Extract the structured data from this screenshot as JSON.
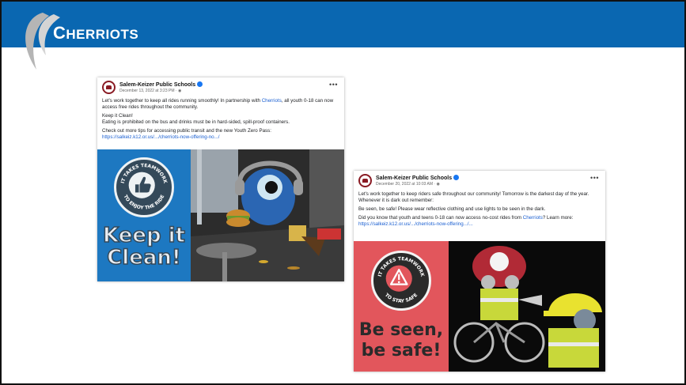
{
  "brand": {
    "name_first": "C",
    "name_rest": "HERRIOTS"
  },
  "post1": {
    "org": "Salem-Keizer Public Schools",
    "date": "December 13, 2022 at 3:23 PM · ",
    "line1_pre": "Let's work together to keep all rides running smoothly! In partnership with ",
    "line1_link": "Cherriots",
    "line1_post": ", all youth 0-18 can now access free rides throughout the community.",
    "line2": "Keep it Clean!",
    "line3": "Eating is prohibited on the bus and drinks must be in hard-sided, spill-proof containers.",
    "line4": "Check out more tips for accessing public transit and the new Youth Zero Pass:",
    "url": "https://salkeiz.k12.or.us/.../cherriots-now-offering-no.../",
    "badge_top": "IT TAKES TEAMWORK",
    "badge_bottom": "TO ENJOY THE RIDE",
    "big1": "Keep it",
    "big2": "Clean!"
  },
  "post2": {
    "org": "Salem-Keizer Public Schools",
    "date": "December 20, 2022 at 10:03 AM · ",
    "line1": "Let's work together to keep riders safe throughout our community! Tomorrow is the darkest day of the year. Whenever it is dark out remember:",
    "line2": "Be seen, be safe! Please wear reflective clothing and use lights to be seen in the dark.",
    "line3_pre": "Did you know that youth and teens 0-18 can now access no-cost rides from ",
    "line3_link": "Cherriots",
    "line3_mid": "? Learn more: ",
    "url": "https://salkeiz.k12.or.us/.../cherriots-now-offering.../...",
    "badge_top": "IT TAKES TEAMWORK",
    "badge_bottom": "TO STAY SAFE",
    "big1": "Be seen,",
    "big2": "be safe!"
  },
  "colors": {
    "header": "#0a67b1",
    "clean_blue": "#1d78c1",
    "safe_red": "#e2565c",
    "link": "#1a5fd1"
  }
}
